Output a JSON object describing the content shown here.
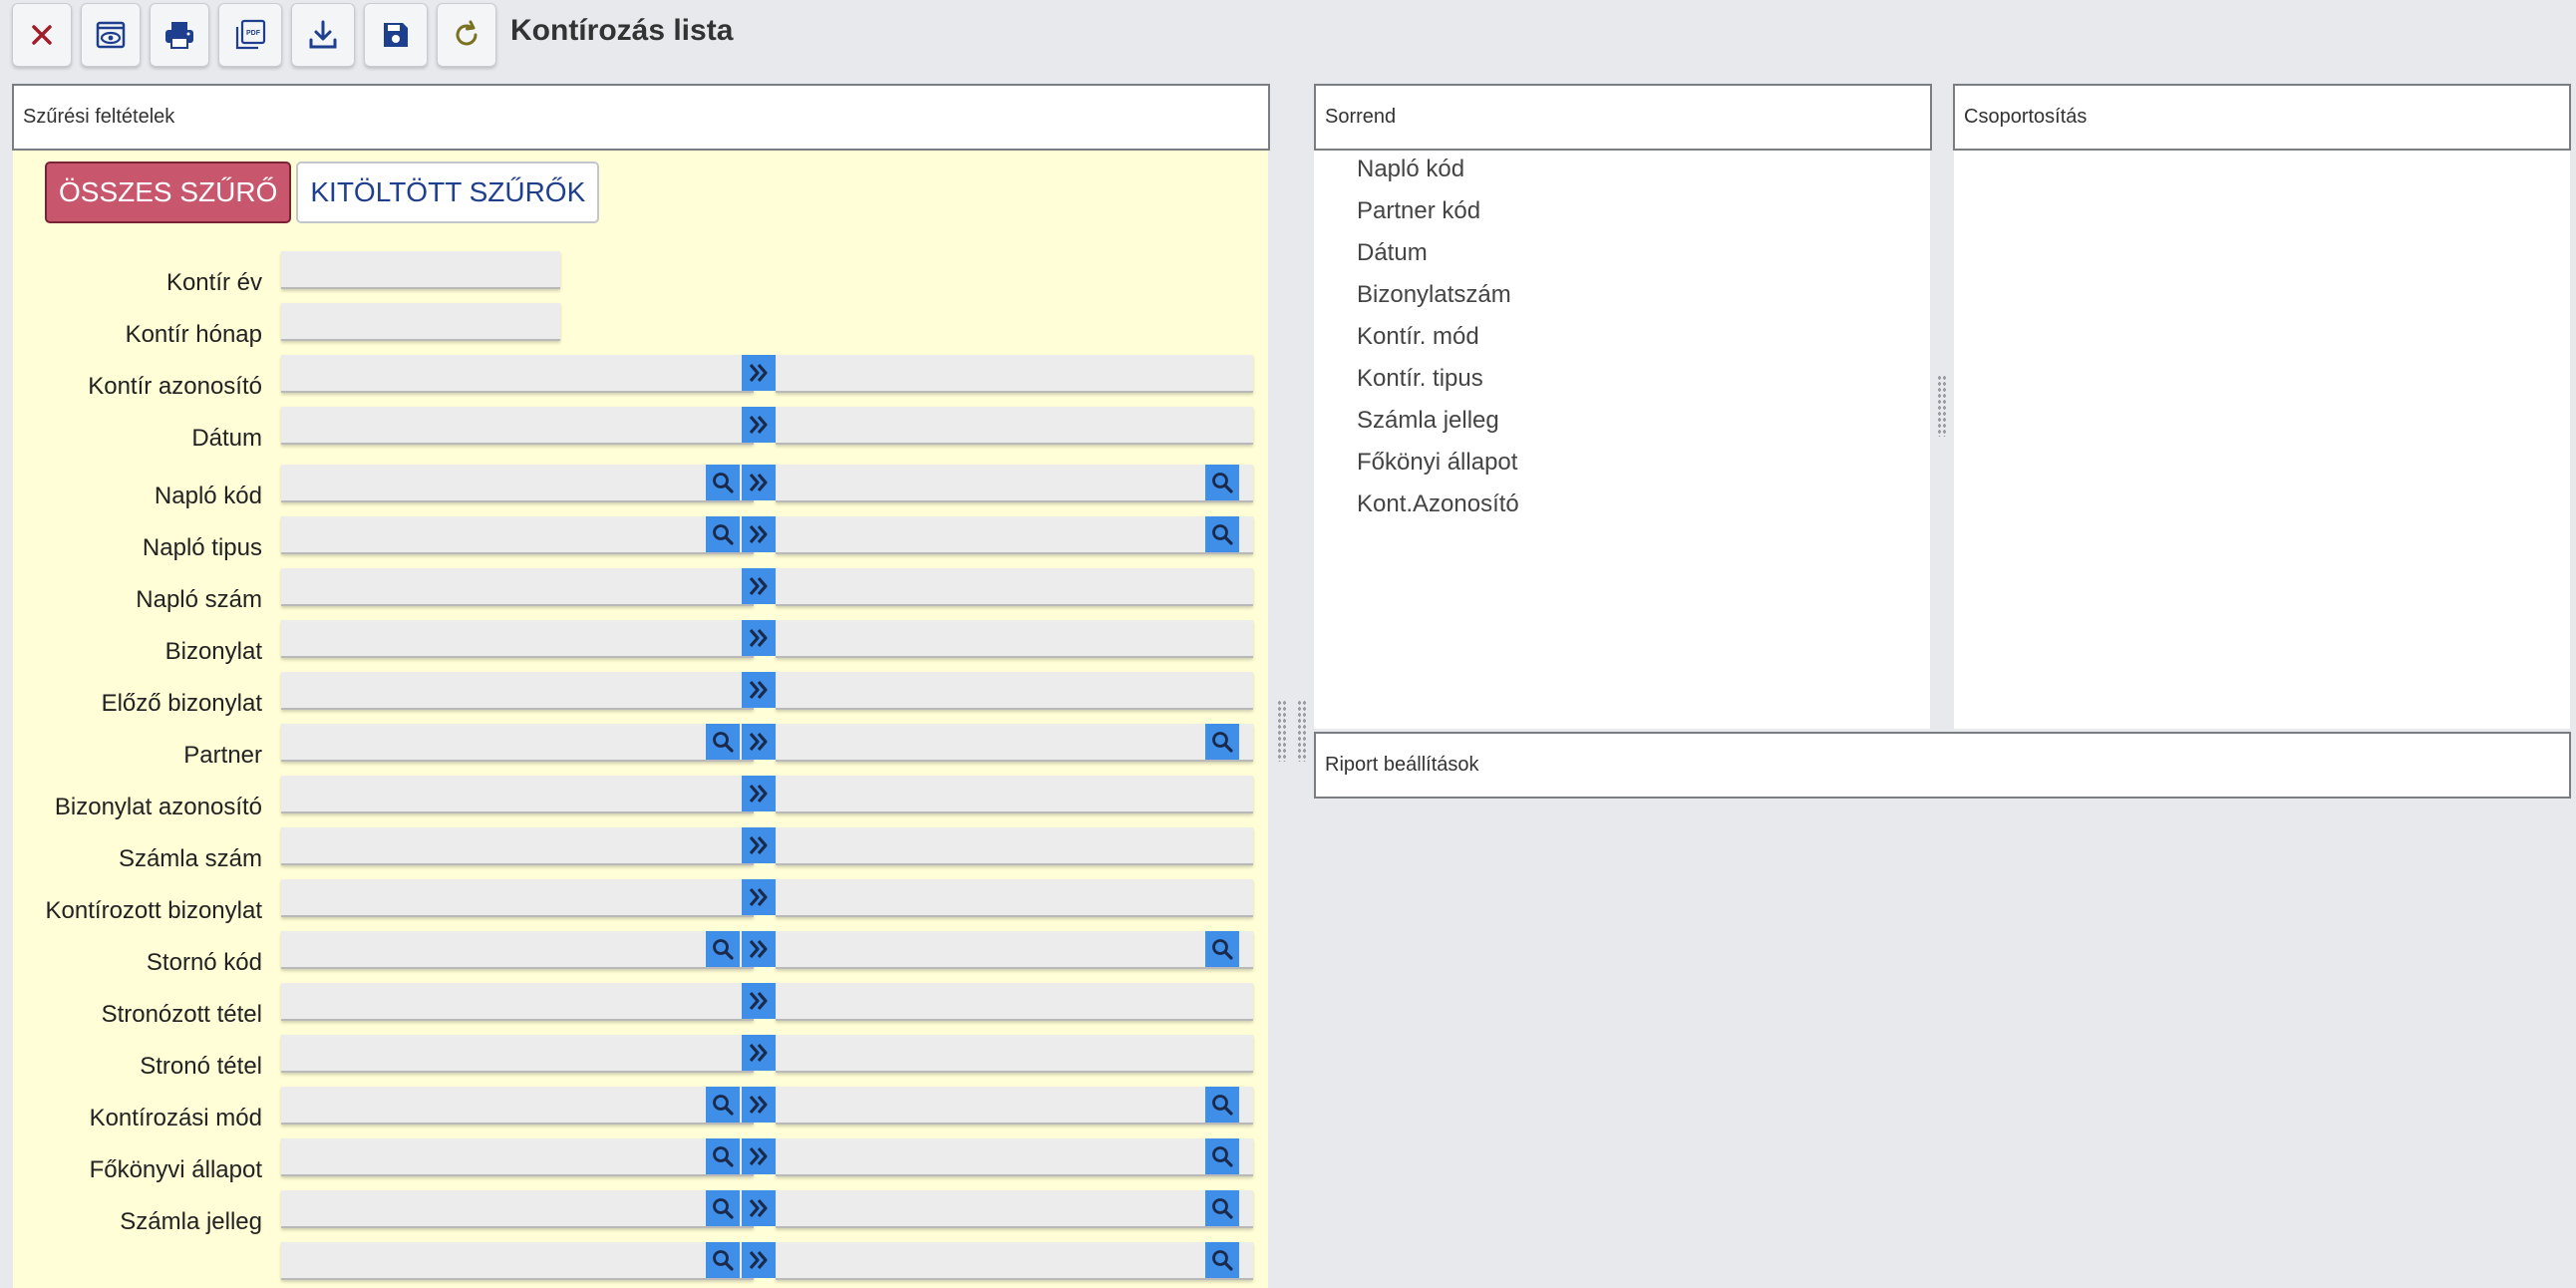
{
  "title": "Kontírozás lista",
  "toolbar": {
    "buttons": [
      {
        "name": "close-button",
        "icon": "close-icon"
      },
      {
        "name": "preview-button",
        "icon": "eye-icon"
      },
      {
        "name": "print-button",
        "icon": "printer-icon"
      },
      {
        "name": "pdf-button",
        "icon": "pdf-icon",
        "icon_text": "PDF"
      },
      {
        "name": "download-button",
        "icon": "download-icon"
      },
      {
        "name": "save-button",
        "icon": "save-icon"
      },
      {
        "name": "refresh-button",
        "icon": "refresh-icon"
      }
    ]
  },
  "filter_panel": {
    "title": "Szűrési feltételek",
    "tab_all": "ÖSSZES SZŰRŐ",
    "tab_filled": "KITÖLTÖTT SZŰRŐK",
    "rows": [
      {
        "label": "Kontír év",
        "type": "short"
      },
      {
        "label": "Kontír hónap",
        "type": "short"
      },
      {
        "label": "Kontír azonosító",
        "type": "range"
      },
      {
        "label": "Dátum",
        "type": "range"
      },
      {
        "label": "Napló kód",
        "type": "range-lookup"
      },
      {
        "label": "Napló tipus",
        "type": "range-lookup"
      },
      {
        "label": "Napló szám",
        "type": "range"
      },
      {
        "label": "Bizonylat",
        "type": "range"
      },
      {
        "label": "Előző bizonylat",
        "type": "range"
      },
      {
        "label": "Partner",
        "type": "range-lookup"
      },
      {
        "label": "Bizonylat azonosító",
        "type": "range"
      },
      {
        "label": "Számla szám",
        "type": "range"
      },
      {
        "label": "Kontírozott bizonylat",
        "type": "range"
      },
      {
        "label": "Stornó kód",
        "type": "range-lookup"
      },
      {
        "label": "Stronózott tétel",
        "type": "range"
      },
      {
        "label": "Stronó tétel",
        "type": "range"
      },
      {
        "label": "Kontírozási mód",
        "type": "range-lookup"
      },
      {
        "label": "Főkönyvi állapot",
        "type": "range-lookup"
      },
      {
        "label": "Számla jelleg",
        "type": "range-lookup"
      },
      {
        "label": "",
        "type": "range-lookup"
      }
    ]
  },
  "sort_panel": {
    "title": "Sorrend",
    "items": [
      "Napló kód",
      "Partner kód",
      "Dátum",
      "Bizonylatszám",
      "Kontír. mód",
      "Kontír. tipus",
      "Számla jelleg",
      "Főkönyi állapot",
      "Kont.Azonosító"
    ]
  },
  "group_panel": {
    "title": "Csoportosítás"
  },
  "report_panel": {
    "title": "Riport beállítások"
  },
  "colors": {
    "accent_blue": "#3f8ee8",
    "active_tab": "#c8576e",
    "filter_bg": "#fffed6",
    "background": "#e8e9ec"
  }
}
